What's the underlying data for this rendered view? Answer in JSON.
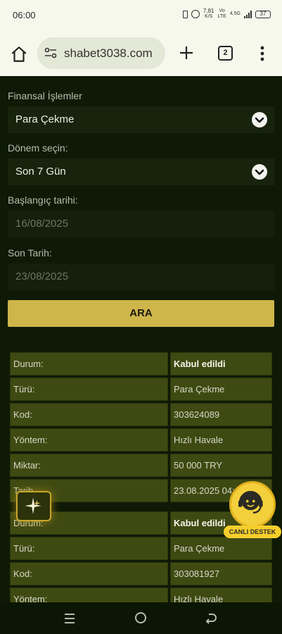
{
  "status_bar": {
    "time": "06:00",
    "net_speed_value": "7,81",
    "net_speed_unit": "K/S",
    "carrier_1": "Vo",
    "carrier_2": "LTE",
    "network_type": "4.5G",
    "battery": "37",
    "icons": [
      "vibrate-icon",
      "alarm-icon",
      "signal-icon",
      "battery-icon"
    ]
  },
  "browser": {
    "url": "shabet3038.com",
    "tab_count": "2",
    "icons": [
      "home-icon",
      "site-settings-icon",
      "plus-icon",
      "tabs-icon",
      "more-vert-icon"
    ]
  },
  "form": {
    "category_label": "Finansal İşlemler",
    "category_value": "Para Çekme",
    "period_label": "Dönem seçin:",
    "period_value": "Son 7 Gün",
    "start_label": "Başlangıç tarihi:",
    "start_value": "16/08/2025",
    "end_label": "Son Tarih:",
    "end_value": "23/08/2025",
    "search_label": "ARA"
  },
  "transactions": [
    {
      "rows": [
        {
          "key": "Durum:",
          "value": "Kabul edildi",
          "bold": true
        },
        {
          "key": "Türü:",
          "value": "Para Çekme"
        },
        {
          "key": "Kod:",
          "value": "303624089"
        },
        {
          "key": "Yöntem:",
          "value": "Hızlı Havale"
        },
        {
          "key": "Miktar:",
          "value": "50 000 TRY"
        },
        {
          "key": "Tarih",
          "value": "23.08.2025 04:"
        }
      ]
    },
    {
      "rows": [
        {
          "key": "Durum:",
          "value": "Kabul edildi",
          "bold": true
        },
        {
          "key": "Türü:",
          "value": "Para Çekme"
        },
        {
          "key": "Kod:",
          "value": "303081927"
        },
        {
          "key": "Yöntem:",
          "value": "Hızlı Havale"
        }
      ]
    }
  ],
  "live_support": {
    "label": "CANLI DESTEK"
  },
  "colors": {
    "page_bg": "#0f1a06",
    "button_gold": "#cfb64b",
    "table_cell": "#3f4a12",
    "support_yellow": "#f3cf3b"
  }
}
